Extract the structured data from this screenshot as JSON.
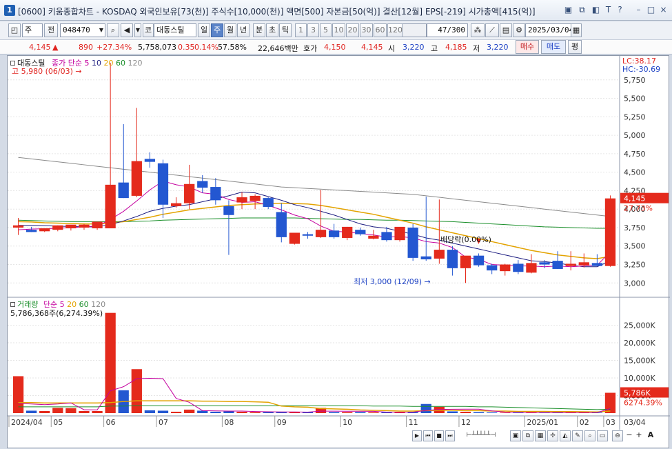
{
  "window": {
    "number": "1",
    "title": "[0600] 키움종합차트 - KOSDAQ 외국인보유[73(천)] 주식수[10,000(천)] 액면[500] 자본금[50(억)] 결산[12월] EPS[-219] 시가총액[415(억)]"
  },
  "toolbar": {
    "period_combo": "주",
    "prev_label": "전",
    "code": "048470",
    "market_tag": "코",
    "stock_name": "대동스틸",
    "periods": [
      "일",
      "주",
      "월",
      "년",
      "분",
      "초",
      "틱"
    ],
    "selected_period": "주",
    "intervals": [
      "1",
      "3",
      "5",
      "10",
      "20",
      "30",
      "60",
      "120"
    ],
    "count": "47",
    "count_total": "/300",
    "date": "2025/03/04"
  },
  "quote": {
    "price": "4,145",
    "change_arrow": "▲",
    "change": "890",
    "change_pct": "+27.34%",
    "volume": "5,758,073",
    "vol_ratio": "0.35",
    "turnover_pct": "0.14%",
    "turnover2": "57.58%",
    "amount": "22,646백만",
    "ask_label": "호가",
    "ask1": "4,150",
    "bid1": "4,145",
    "open_label": "시",
    "open": "3,220",
    "high_label": "고",
    "high": "4,185",
    "low_label": "저",
    "low": "3,220",
    "buy_btn": "매수",
    "sell_btn": "매도",
    "avg_btn": "평"
  },
  "legend": {
    "name": "대동스틸",
    "series": [
      "종가 단순",
      "5",
      "10",
      "20",
      "60",
      "120"
    ],
    "high_note": "고 5,980 (06/03)",
    "low_note": "최저 3,000 (12/09)",
    "dividend_note": "배당락(0.00%)",
    "lc": "LC:38.17",
    "hc": "HC:-30.69",
    "last_price": "4,145",
    "last_pct": "27.73%"
  },
  "price_axis": [
    "5,750",
    "5,500",
    "5,250",
    "5,000",
    "4,750",
    "4,500",
    "4,250",
    "4,000",
    "3,750",
    "3,500",
    "3,250",
    "3,000"
  ],
  "volume_legend": {
    "title": "거래량",
    "series": [
      "단순",
      "5",
      "20",
      "60",
      "120"
    ],
    "info": "5,786,368주(6,274.39%)",
    "last_vol": "5,786K",
    "last_pct": "6274.39%"
  },
  "volume_axis": [
    "25,000K",
    "20,000K",
    "15,000K",
    "10,000K",
    "5,000K"
  ],
  "x_axis": [
    "2024/04",
    "05",
    "06",
    "07",
    "08",
    "09",
    "10",
    "11",
    "12",
    "2025/01",
    "02",
    "03",
    "03/04"
  ],
  "colors": {
    "up": "#e42a1c",
    "down": "#2357d1",
    "ma5": "#c4009f",
    "ma10": "#1c1c80",
    "ma20": "#e3a300",
    "ma60": "#1a8f2a",
    "ma120": "#8a8a8a"
  },
  "chart_data": {
    "type": "candlestick",
    "ylim": [
      2900,
      6000
    ],
    "candles": [
      {
        "o": 3750,
        "h": 3880,
        "l": 3650,
        "c": 3780
      },
      {
        "o": 3720,
        "h": 3760,
        "l": 3690,
        "c": 3690
      },
      {
        "o": 3700,
        "h": 3740,
        "l": 3690,
        "c": 3740
      },
      {
        "o": 3720,
        "h": 3780,
        "l": 3700,
        "c": 3780
      },
      {
        "o": 3740,
        "h": 3780,
        "l": 3710,
        "c": 3790
      },
      {
        "o": 3750,
        "h": 3800,
        "l": 3720,
        "c": 3790
      },
      {
        "o": 3740,
        "h": 3800,
        "l": 3720,
        "c": 3830
      },
      {
        "o": 3740,
        "h": 5980,
        "l": 3740,
        "c": 4330
      },
      {
        "o": 4360,
        "h": 5150,
        "l": 4150,
        "c": 4150
      },
      {
        "o": 4180,
        "h": 5370,
        "l": 4160,
        "c": 4650
      },
      {
        "o": 4680,
        "h": 4770,
        "l": 4560,
        "c": 4640
      },
      {
        "o": 4620,
        "h": 4670,
        "l": 3880,
        "c": 4060
      },
      {
        "o": 4040,
        "h": 4160,
        "l": 4020,
        "c": 4080
      },
      {
        "o": 4080,
        "h": 4600,
        "l": 4000,
        "c": 4340
      },
      {
        "o": 4380,
        "h": 4460,
        "l": 4220,
        "c": 4290
      },
      {
        "o": 4300,
        "h": 4420,
        "l": 4060,
        "c": 4120
      },
      {
        "o": 4040,
        "h": 4120,
        "l": 3380,
        "c": 3920
      },
      {
        "o": 4090,
        "h": 4230,
        "l": 4000,
        "c": 4160
      },
      {
        "o": 4110,
        "h": 4200,
        "l": 4000,
        "c": 4180
      },
      {
        "o": 4150,
        "h": 4160,
        "l": 4000,
        "c": 4030
      },
      {
        "o": 3960,
        "h": 4080,
        "l": 3550,
        "c": 3620
      },
      {
        "o": 3530,
        "h": 3650,
        "l": 3520,
        "c": 3680
      },
      {
        "o": 3660,
        "h": 3690,
        "l": 3600,
        "c": 3640
      },
      {
        "o": 3620,
        "h": 4260,
        "l": 3610,
        "c": 3720
      },
      {
        "o": 3710,
        "h": 3800,
        "l": 3600,
        "c": 3620
      },
      {
        "o": 3610,
        "h": 3760,
        "l": 3580,
        "c": 3760
      },
      {
        "o": 3720,
        "h": 3750,
        "l": 3640,
        "c": 3660
      },
      {
        "o": 3600,
        "h": 3720,
        "l": 3590,
        "c": 3640
      },
      {
        "o": 3690,
        "h": 3760,
        "l": 3560,
        "c": 3580
      },
      {
        "o": 3580,
        "h": 3750,
        "l": 3560,
        "c": 3760
      },
      {
        "o": 3750,
        "h": 3800,
        "l": 3300,
        "c": 3340
      },
      {
        "o": 3360,
        "h": 4170,
        "l": 3300,
        "c": 3320
      },
      {
        "o": 3330,
        "h": 4130,
        "l": 3260,
        "c": 3450
      },
      {
        "o": 3450,
        "h": 3500,
        "l": 3100,
        "c": 3200
      },
      {
        "o": 3200,
        "h": 3340,
        "l": 3000,
        "c": 3370
      },
      {
        "o": 3370,
        "h": 3400,
        "l": 3220,
        "c": 3240
      },
      {
        "o": 3240,
        "h": 3260,
        "l": 3120,
        "c": 3170
      },
      {
        "o": 3160,
        "h": 3260,
        "l": 3100,
        "c": 3250
      },
      {
        "o": 3260,
        "h": 3310,
        "l": 3120,
        "c": 3150
      },
      {
        "o": 3140,
        "h": 3390,
        "l": 3130,
        "c": 3270
      },
      {
        "o": 3280,
        "h": 3310,
        "l": 3200,
        "c": 3250
      },
      {
        "o": 3300,
        "h": 3430,
        "l": 3190,
        "c": 3190
      },
      {
        "o": 3230,
        "h": 3430,
        "l": 3170,
        "c": 3260
      },
      {
        "o": 3240,
        "h": 3400,
        "l": 3210,
        "c": 3280
      },
      {
        "o": 3270,
        "h": 3390,
        "l": 3230,
        "c": 3230
      },
      {
        "o": 3230,
        "h": 4185,
        "l": 3220,
        "c": 4145
      }
    ],
    "ma5": [
      3720,
      3730,
      3735,
      3740,
      3750,
      3760,
      3770,
      3860,
      3970,
      4110,
      4260,
      4380,
      4330,
      4300,
      4220,
      4200,
      4130,
      4090,
      4100,
      4050,
      3990,
      3920,
      3870,
      3770,
      3700,
      3690,
      3670,
      3650,
      3620,
      3630,
      3610,
      3560,
      3540,
      3480,
      3350,
      3320,
      3250,
      3240,
      3230,
      3230,
      3220,
      3230,
      3220,
      3230,
      3240,
      3420
    ],
    "ma10": [
      3780,
      3780,
      3775,
      3770,
      3765,
      3760,
      3760,
      3790,
      3840,
      3900,
      3970,
      4010,
      4040,
      4060,
      4100,
      4140,
      4180,
      4230,
      4220,
      4170,
      4120,
      4060,
      4020,
      3970,
      3920,
      3860,
      3800,
      3760,
      3740,
      3700,
      3660,
      3610,
      3580,
      3540,
      3500,
      3460,
      3420,
      3380,
      3340,
      3300,
      3290,
      3270,
      3240,
      3220,
      3220,
      3300
    ],
    "ma20": [
      3830,
      3825,
      3815,
      3810,
      3805,
      3800,
      3800,
      3810,
      3830,
      3860,
      3890,
      3930,
      3960,
      3990,
      4010,
      4030,
      4050,
      4060,
      4070,
      4075,
      4080,
      4075,
      4070,
      4050,
      4020,
      3990,
      3960,
      3930,
      3890,
      3850,
      3810,
      3760,
      3720,
      3680,
      3640,
      3600,
      3560,
      3520,
      3480,
      3440,
      3410,
      3380,
      3360,
      3340,
      3330,
      3360
    ],
    "ma60": [
      3850,
      3845,
      3840,
      3835,
      3830,
      3830,
      3830,
      3830,
      3830,
      3835,
      3840,
      3850,
      3855,
      3860,
      3865,
      3870,
      3875,
      3880,
      3880,
      3880,
      3880,
      3880,
      3875,
      3870,
      3865,
      3860,
      3860,
      3855,
      3850,
      3850,
      3845,
      3840,
      3835,
      3830,
      3820,
      3810,
      3800,
      3790,
      3780,
      3770,
      3760,
      3755,
      3750,
      3745,
      3740,
      3740
    ],
    "ma120": [
      4700,
      4680,
      4660,
      4640,
      4620,
      4600,
      4580,
      4560,
      4540,
      4520,
      4500,
      4480,
      4460,
      4440,
      4420,
      4400,
      4380,
      4360,
      4340,
      4320,
      4300,
      4290,
      4280,
      4270,
      4260,
      4250,
      4240,
      4230,
      4220,
      4210,
      4200,
      4180,
      4160,
      4140,
      4120,
      4100,
      4080,
      4060,
      4040,
      4020,
      4000,
      3980,
      3960,
      3940,
      3920,
      3900
    ],
    "volume": [
      10500,
      700,
      600,
      1500,
      1400,
      600,
      600,
      28500,
      6500,
      12500,
      800,
      700,
      400,
      1000,
      700,
      400,
      500,
      400,
      300,
      300,
      400,
      300,
      300,
      1500,
      300,
      300,
      300,
      250,
      300,
      300,
      300,
      2600,
      1800,
      500,
      400,
      300,
      200,
      150,
      150,
      200,
      150,
      150,
      200,
      200,
      150,
      5786
    ],
    "vol_ma5": [
      2800,
      2600,
      2400,
      2600,
      2900,
      960,
      940,
      6340,
      7520,
      9800,
      9900,
      9800,
      4180,
      3080,
      720,
      640,
      600,
      600,
      460,
      380,
      340,
      340,
      300,
      560,
      560,
      540,
      540,
      520,
      300,
      290,
      290,
      750,
      1060,
      1100,
      1120,
      1120,
      640,
      320,
      240,
      200,
      170,
      170,
      170,
      180,
      170,
      1300
    ],
    "vol_ma20": [
      3000,
      3000,
      2900,
      2900,
      2900,
      2900,
      2900,
      3000,
      3300,
      3500,
      3500,
      3500,
      3500,
      3500,
      3400,
      3400,
      3300,
      3300,
      3200,
      3100,
      2000,
      1800,
      1700,
      1300,
      1200,
      1100,
      900,
      800,
      700,
      600,
      600,
      700,
      800,
      800,
      700,
      700,
      600,
      600,
      500,
      500,
      500,
      450,
      450,
      400,
      350,
      600
    ],
    "vol_ma60": [
      1800,
      1800,
      1800,
      1800,
      1800,
      1800,
      1800,
      2000,
      2000,
      2100,
      2100,
      2100,
      2100,
      2100,
      2100,
      2100,
      2100,
      2100,
      2100,
      2100,
      2100,
      2100,
      2100,
      2100,
      2100,
      2100,
      2100,
      2000,
      2000,
      2000,
      1900,
      1900,
      1900,
      1900,
      1900,
      1800,
      1800,
      1700,
      1600,
      1500,
      1400,
      1300,
      1200,
      1100,
      1000,
      1100
    ]
  }
}
